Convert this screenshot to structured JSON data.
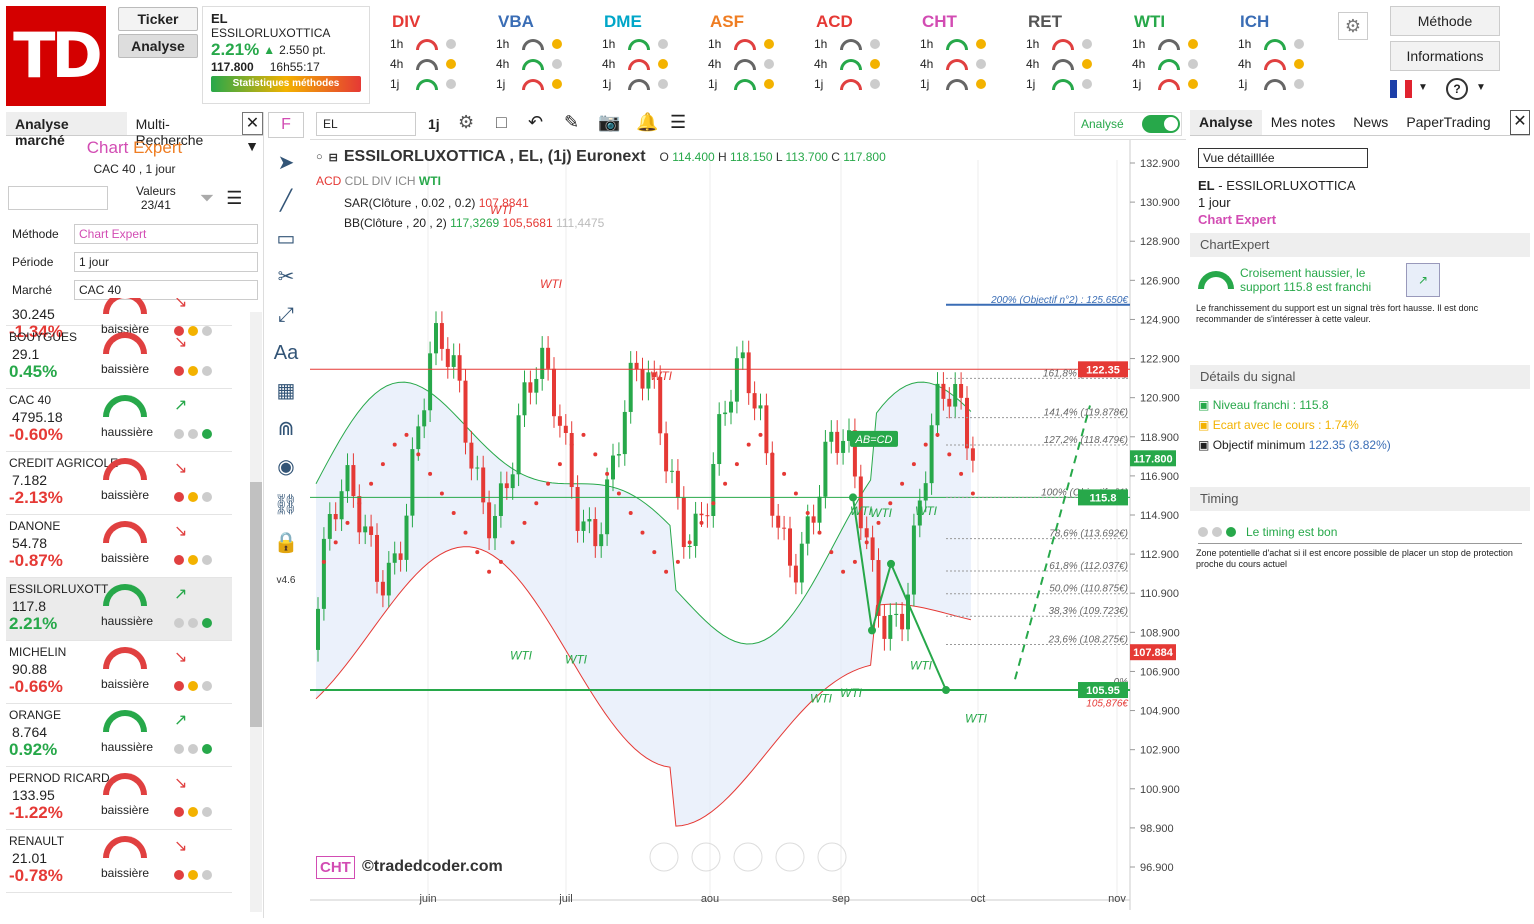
{
  "logo": "TD",
  "buttons": {
    "ticker": "Ticker",
    "analyse": "Analyse",
    "methode": "Méthode",
    "informations": "Informations"
  },
  "ticker": {
    "symbol": "EL",
    "name": "ESSILORLUXOTTICA",
    "change": "2.21%",
    "change_pt": "2.550 pt.",
    "price": "117.800",
    "time": "16h55:17",
    "stats": "Statistiques méthodes"
  },
  "methods": [
    {
      "name": "DIV",
      "color": "#e53935",
      "rows": [
        "1h",
        "4h",
        "1j"
      ]
    },
    {
      "name": "VBA",
      "color": "#3a6db5",
      "rows": [
        "1h",
        "4h",
        "1j"
      ]
    },
    {
      "name": "DME",
      "color": "#00a6c8",
      "rows": [
        "1h",
        "4h",
        "1j"
      ]
    },
    {
      "name": "ASF",
      "color": "#ef7d22",
      "rows": [
        "1h",
        "4h",
        "1j"
      ]
    },
    {
      "name": "ACD",
      "color": "#e53935",
      "rows": [
        "1h",
        "4h",
        "1j"
      ]
    },
    {
      "name": "CHT",
      "color": "#d24cb3",
      "rows": [
        "1h",
        "4h",
        "1j"
      ]
    },
    {
      "name": "RET",
      "color": "#555555",
      "rows": [
        "1h",
        "4h",
        "1j"
      ]
    },
    {
      "name": "WTI",
      "color": "#27a84a",
      "rows": [
        "1h",
        "4h",
        "1j"
      ]
    },
    {
      "name": "ICH",
      "color": "#3a6db5",
      "rows": [
        "1h",
        "4h",
        "1j"
      ]
    }
  ],
  "left": {
    "tab1": "Analyse marché",
    "tab2": "Multi-Recherche",
    "title1": "Chart",
    "title2": "Expert",
    "subtitle": "CAC 40 , 1 jour",
    "valeurs_label": "Valeurs",
    "valeurs": "23/41",
    "methode_label": "Méthode",
    "methode": "Chart Expert",
    "periode_label": "Période",
    "periode": "1 jour",
    "marche_label": "Marché",
    "marche": "CAC 40",
    "stocks": [
      {
        "name": "",
        "price": "30.245",
        "pct": "-1.34%",
        "trend": "baissière",
        "up": false
      },
      {
        "name": "BOUYGUES",
        "price": "29.1",
        "pct": "0.45%",
        "trend": "baissière",
        "up": false
      },
      {
        "name": "CAC 40",
        "price": "4795.18",
        "pct": "-0.60%",
        "trend": "haussière",
        "up": true
      },
      {
        "name": "CREDIT AGRICOLE",
        "price": "7.182",
        "pct": "-2.13%",
        "trend": "baissière",
        "up": false
      },
      {
        "name": "DANONE",
        "price": "54.78",
        "pct": "-0.87%",
        "trend": "baissière",
        "up": false
      },
      {
        "name": "ESSILORLUXOTT",
        "price": "117.8",
        "pct": "2.21%",
        "trend": "haussière",
        "up": true
      },
      {
        "name": "MICHELIN",
        "price": "90.88",
        "pct": "-0.66%",
        "trend": "baissière",
        "up": false
      },
      {
        "name": "ORANGE",
        "price": "8.764",
        "pct": "0.92%",
        "trend": "haussière",
        "up": true
      },
      {
        "name": "PERNOD RICARD",
        "price": "133.95",
        "pct": "-1.22%",
        "trend": "baissière",
        "up": false
      },
      {
        "name": "RENAULT",
        "price": "21.01",
        "pct": "-0.78%",
        "trend": "baissière",
        "up": false
      }
    ]
  },
  "chart": {
    "symbol_input": "EL",
    "tf": "1j",
    "analyse": "Analysé",
    "title": "ESSILORLUXOTTICA , EL, (1j) Euronext",
    "O": "114.400",
    "H": "118.150",
    "L": "113.700",
    "C": "117.800",
    "ind": "ACD CDL DIV ICH WTI",
    "sar": "SAR(Clôture , 0.02 , 0.2)",
    "sar_v": "107,8841",
    "bb": "BB(Clôture , 20 , 2)",
    "bb_v1": "117,3269",
    "bb_v2": "105,5681",
    "bb_v3": "111,4475",
    "prices": [
      "132.900",
      "130.900",
      "128.900",
      "126.900",
      "124.900",
      "122.900",
      "120.900",
      "118.900",
      "116.900",
      "114.900",
      "112.900",
      "110.900",
      "108.900",
      "106.900",
      "104.900",
      "102.900",
      "100.900",
      "98.900",
      "96.900"
    ],
    "months": [
      "juin",
      "juil",
      "aou",
      "sep",
      "oct",
      "nov"
    ],
    "fib": [
      "200% (Objectif n°2) : 125.650€",
      "161,8% (121.887€)",
      "141,4% (119.878€)",
      "127,2% (118.479€)",
      "100% (Objectif n°1)",
      "78,6% (113.692€)",
      "61,8% (112.037€)",
      "50,0% (110.875€)",
      "38,3% (109.723€)",
      "23,6% (108.275€)",
      "0%",
      "105,876€"
    ],
    "tags": {
      "t1": "122.35",
      "t2": "117.800",
      "t3": "115.8",
      "t4": "107.884",
      "t5": "105.95"
    },
    "abcd": "AB=CD",
    "watermark": "©tradedcoder.com",
    "cht": "CHT",
    "version": "v4.6"
  },
  "right": {
    "tab1": "Analyse",
    "tab2": "Mes notes",
    "tab3": "News",
    "tab4": "PaperTrading",
    "view": "Vue détailllée",
    "sym": "EL",
    "name": "ESSILORLUXOTTICA",
    "period": "1 jour",
    "method": "Chart Expert",
    "sec1": "ChartExpert",
    "signal": "Croisement haussier, le support 115.8 est franchi",
    "desc": "Le franchissement du support est un signal très fort hausse. Il est donc recommander de s'intéresser à cette valeur.",
    "sec2": "Détails du signal",
    "d1": "Niveau franchi : 115.8",
    "d2": "Ecart avec le cours : 1.74%",
    "d3a": "Objectif minimum ",
    "d3b": "122.35 (3.82%)",
    "sec3": "Timing",
    "timing": "Le timing est bon",
    "timing_desc": "Zone potentielle d'achat si il est encore possible de placer un stop de protection proche du cours actuel"
  }
}
